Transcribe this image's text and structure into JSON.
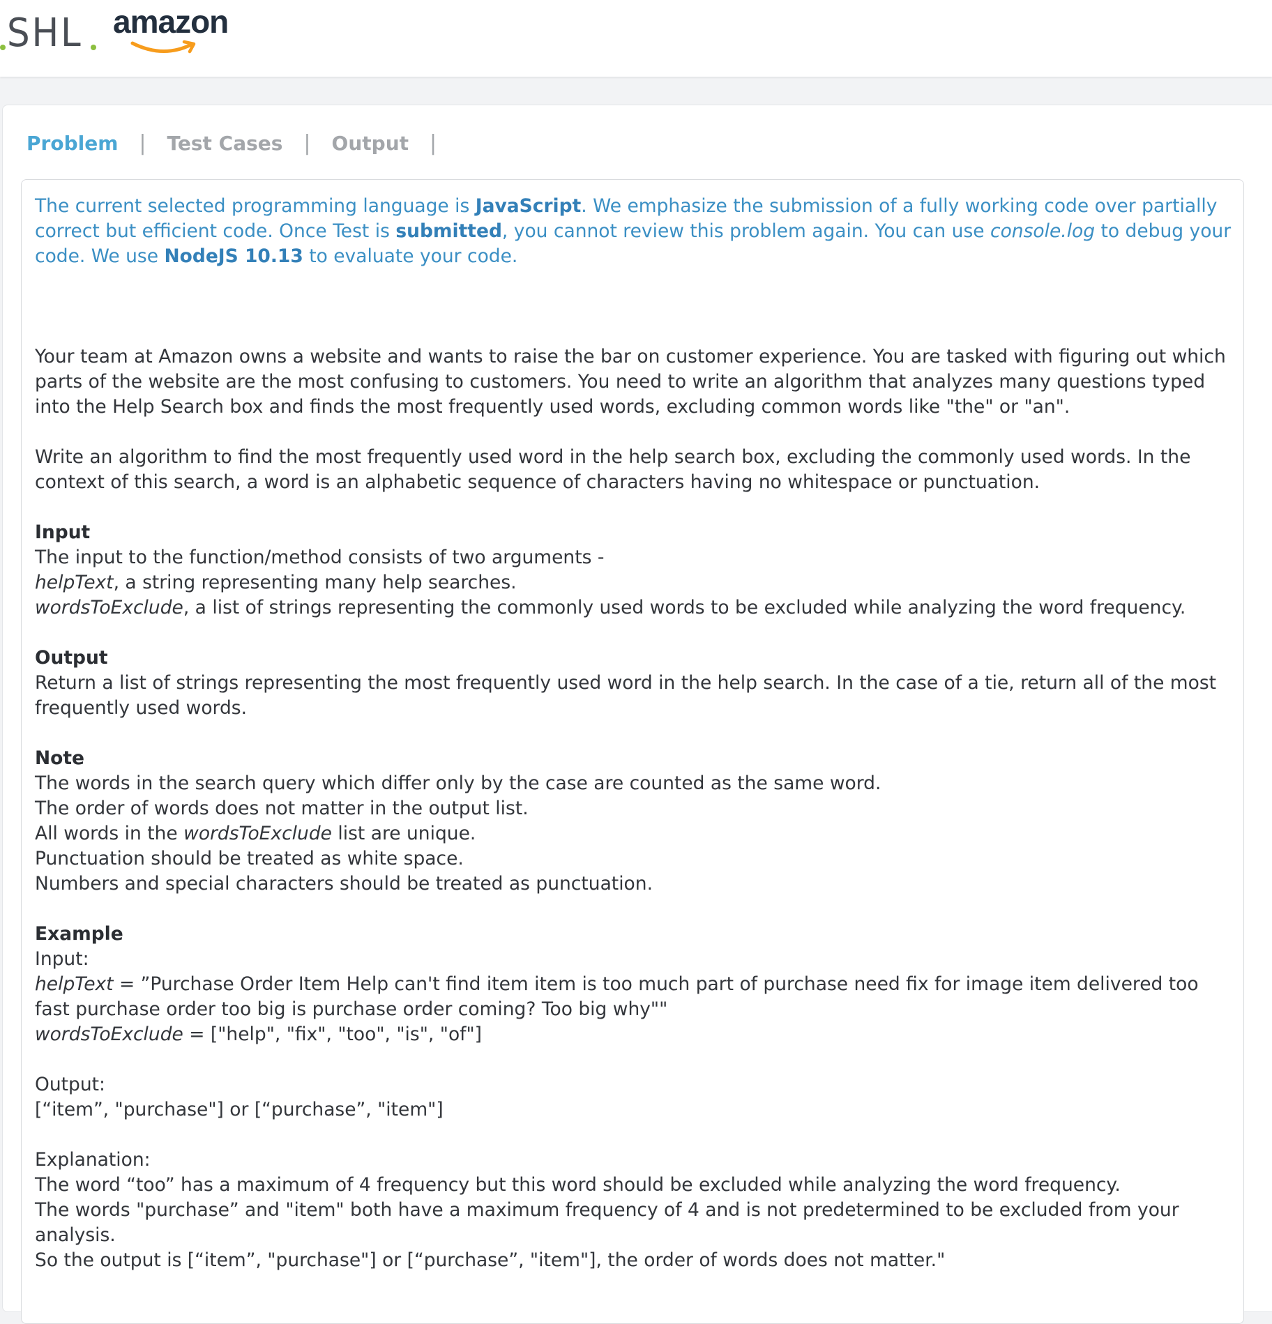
{
  "header": {
    "brand_shl": "SHL",
    "brand_amazon": "amazon"
  },
  "tabs": [
    {
      "label": "Problem",
      "active": true
    },
    {
      "label": "Test Cases",
      "active": false
    },
    {
      "label": "Output",
      "active": false
    }
  ],
  "tab_separator": "|",
  "notice": {
    "p1": "The current selected programming language is ",
    "language": "JavaScript",
    "p2": ". We emphasize the submission of a fully working code over partially correct but efficient code. Once Test is ",
    "submitted": "submitted",
    "p3": ", you cannot review this problem again. You can use ",
    "console_log": "console.log",
    "p4": " to debug your code. We use ",
    "node_version": "NodeJS 10.13",
    "p5": " to evaluate your code."
  },
  "problem": {
    "intro": "Your team at Amazon owns a website and wants to raise the bar on customer experience. You are tasked with figuring out which parts of the website are the most confusing to customers. You need to write an algorithm that analyzes many questions typed into the Help Search box and finds the most frequently used words, excluding common words like \"the\" or \"an\".",
    "task": "Write an algorithm to find the most frequently used word in the help search box, excluding the commonly used words. In the context of this search, a word is an alphabetic sequence of characters having no whitespace or punctuation.",
    "input_title": "Input",
    "input_line1": "The input to the function/method consists of two arguments -",
    "input_arg1_name": "helpText",
    "input_arg1_desc": ", a string representing many help searches.",
    "input_arg2_name": "wordsToExclude",
    "input_arg2_desc": ", a list of strings representing the commonly used words to be excluded while analyzing the word frequency.",
    "output_title": "Output",
    "output_desc": "Return a list of strings representing the most frequently used word in the help search. In the case of a tie, return all of the most frequently used words.",
    "note_title": "Note",
    "note1": "The words in the search query which differ only by the case are counted as the same word.",
    "note2": "The order of words does not matter in the output list.",
    "note3_pre": "All words in the ",
    "note3_em": "wordsToExclude",
    "note3_post": " list are unique.",
    "note4": "Punctuation should be treated as white space.",
    "note5": "Numbers and special characters should be treated as punctuation.",
    "example_title": "Example",
    "ex_input_label": "Input:",
    "ex_help_name": "helpText",
    "ex_help_value": " = ”Purchase Order Item Help can't find item item is too much part of purchase need fix for image item delivered too fast purchase order too big is purchase order coming? Too big why\"\"",
    "ex_exclude_name": "wordsToExclude",
    "ex_exclude_value": " = [\"help\", \"fix\", \"too\", \"is\", \"of\"]",
    "ex_output_label": "Output:",
    "ex_output_value": "[“item”, \"purchase\"] or [“purchase”, \"item\"]",
    "ex_expl_label": "Explanation:",
    "ex_expl1": "The word “too” has a maximum of 4 frequency but this word should be excluded while analyzing the word frequency.",
    "ex_expl2": "The words \"purchase” and \"item\" both have a maximum frequency of 4 and is not predetermined to be excluded from your analysis.",
    "ex_expl3": "So the output is [“item”, \"purchase\"] or [“purchase”, \"item\"], the order of words does not matter.\""
  },
  "colors": {
    "accent_blue": "#4aa6d4",
    "notice_blue": "#3b8fc4",
    "tab_inactive": "#a3a6aa",
    "shl_green": "#8cbf3f",
    "amazon_orange": "#f79c1c"
  }
}
